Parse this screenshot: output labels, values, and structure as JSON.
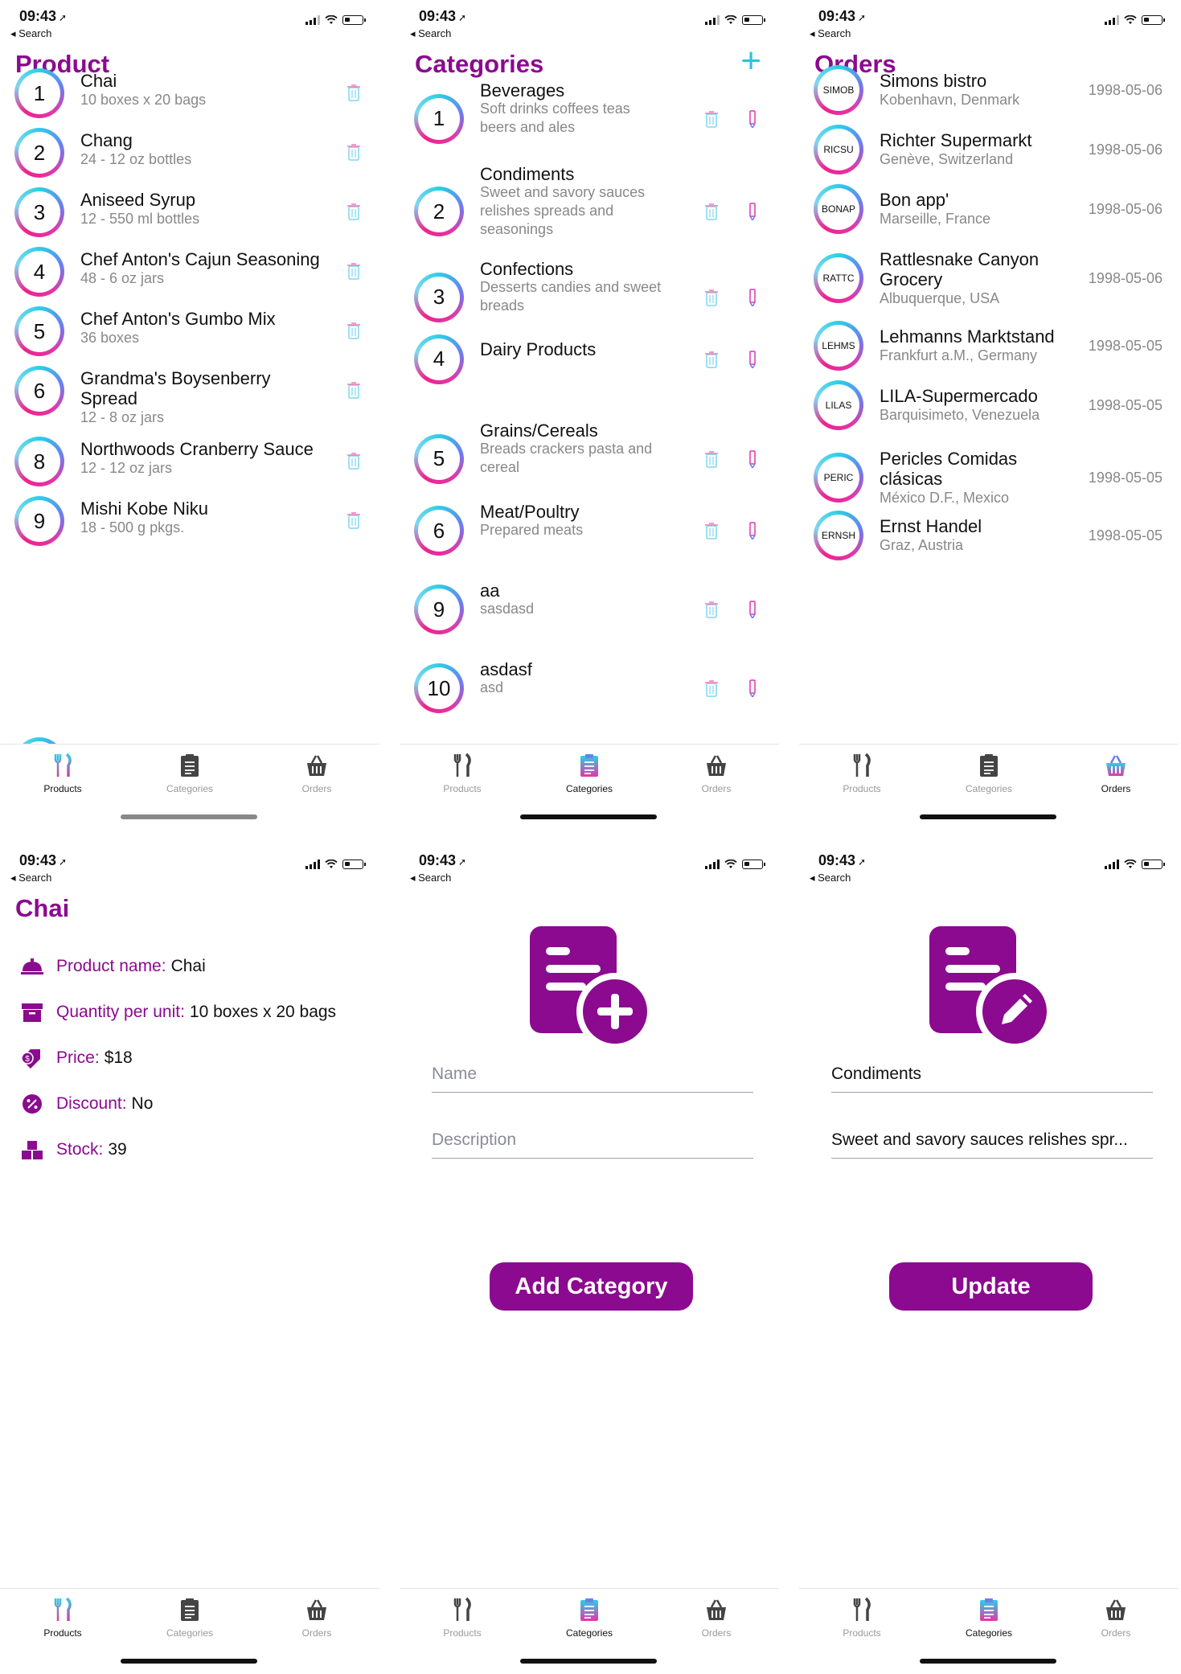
{
  "status": {
    "time": "09:43",
    "back": "Search"
  },
  "colors": {
    "accent": "#8b0a8f",
    "plus": "#2cc3de"
  },
  "tabs": {
    "products": "Products",
    "categories": "Categories",
    "orders": "Orders"
  },
  "products_screen": {
    "title": "Product",
    "items": [
      {
        "num": "1",
        "name": "Chai",
        "sub": "10 boxes x 20 bags"
      },
      {
        "num": "2",
        "name": "Chang",
        "sub": "24 - 12 oz bottles"
      },
      {
        "num": "3",
        "name": "Aniseed Syrup",
        "sub": "12 - 550 ml bottles"
      },
      {
        "num": "4",
        "name": "Chef Anton's Cajun Seasoning",
        "sub": "48 - 6 oz jars"
      },
      {
        "num": "5",
        "name": "Chef Anton's Gumbo Mix",
        "sub": "36 boxes"
      },
      {
        "num": "6",
        "name": "Grandma's Boysenberry\nSpread",
        "sub": "12 - 8 oz jars"
      },
      {
        "num": "8",
        "name": "Northwoods Cranberry Sauce",
        "sub": "12 - 12 oz jars"
      },
      {
        "num": "9",
        "name": "Mishi Kobe Niku",
        "sub": "18 - 500 g pkgs."
      }
    ]
  },
  "categories_screen": {
    "title": "Categories",
    "add_icon": "+",
    "items": [
      {
        "num": "1",
        "name": "Beverages",
        "sub": "Soft drinks coffees teas\nbeers and ales"
      },
      {
        "num": "2",
        "name": "Condiments",
        "sub": "Sweet and savory sauces\nrelishes spreads and\nseasonings"
      },
      {
        "num": "3",
        "name": "Confections",
        "sub": "Desserts candies and sweet\nbreads"
      },
      {
        "num": "4",
        "name": "Dairy Products",
        "sub": ""
      },
      {
        "num": "5",
        "name": "Grains/Cereals",
        "sub": "Breads crackers pasta and\ncereal"
      },
      {
        "num": "6",
        "name": "Meat/Poultry",
        "sub": "Prepared meats"
      },
      {
        "num": "9",
        "name": "aa",
        "sub": "sasdasd"
      },
      {
        "num": "10",
        "name": "asdasf",
        "sub": "asd"
      }
    ]
  },
  "orders_screen": {
    "title": "Orders",
    "items": [
      {
        "code": "SIMOB",
        "name": "Simons bistro",
        "sub": "Kobenhavn, Denmark",
        "date": "1998-05-06"
      },
      {
        "code": "RICSU",
        "name": "Richter Supermarkt",
        "sub": "Genève, Switzerland",
        "date": "1998-05-06"
      },
      {
        "code": "BONAP",
        "name": "Bon app'",
        "sub": "Marseille, France",
        "date": "1998-05-06"
      },
      {
        "code": "RATTC",
        "name": "Rattlesnake Canyon\nGrocery",
        "sub": "Albuquerque, USA",
        "date": "1998-05-06"
      },
      {
        "code": "LEHMS",
        "name": "Lehmanns Marktstand",
        "sub": "Frankfurt a.M., Germany",
        "date": "1998-05-05"
      },
      {
        "code": "LILAS",
        "name": "LILA-Supermercado",
        "sub": "Barquisimeto, Venezuela",
        "date": "1998-05-05"
      },
      {
        "code": "PERIC",
        "name": "Pericles Comidas\nclásicas",
        "sub": "México D.F., Mexico",
        "date": "1998-05-05"
      },
      {
        "code": "ERNSH",
        "name": "Ernst Handel",
        "sub": "Graz, Austria",
        "date": "1998-05-05"
      }
    ]
  },
  "detail_screen": {
    "title": "Chai",
    "rows": [
      {
        "label": "Product name:",
        "value": "Chai",
        "icon": "cloche-icon"
      },
      {
        "label": "Quantity per unit:",
        "value": "10 boxes x 20 bags",
        "icon": "archive-box-icon"
      },
      {
        "label": "Price:",
        "value": "$18",
        "icon": "price-tag-icon"
      },
      {
        "label": "Discount:",
        "value": "No",
        "icon": "percent-badge-icon"
      },
      {
        "label": "Stock:",
        "value": "39",
        "icon": "boxes-icon"
      }
    ]
  },
  "add_category_screen": {
    "name_placeholder": "Name",
    "description_placeholder": "Description",
    "button": "Add Category"
  },
  "edit_category_screen": {
    "name_value": "Condiments",
    "description_value": "Sweet and savory sauces relishes spr...",
    "button": "Update"
  }
}
